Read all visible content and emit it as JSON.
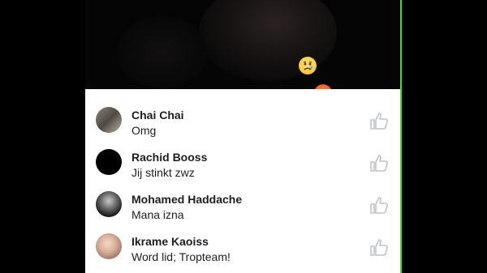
{
  "comments": [
    {
      "name": "Chai Chai",
      "message": "Omg",
      "avatar": "photo"
    },
    {
      "name": "Rachid Booss",
      "message": "Jij stinkt zwz",
      "avatar": "black-circle"
    },
    {
      "name": "Mohamed Haddache",
      "message": "Mana izna",
      "avatar": "photo"
    },
    {
      "name": "Ikrame Kaoiss",
      "message": "Word lid; Tropteam!",
      "avatar": "photo"
    }
  ],
  "reactions": [
    "sad-emoji",
    "angry-emoji"
  ],
  "colors": {
    "panel": "#ffffff",
    "text": "#1c1e21",
    "like_icon": "#bec3c9",
    "border_accent": "#3ddc2e"
  }
}
